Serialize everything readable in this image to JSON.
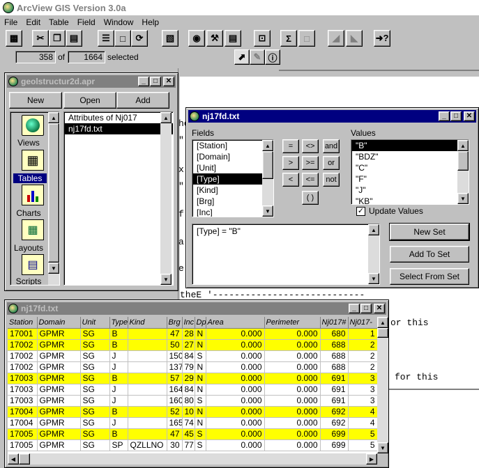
{
  "app": {
    "title": "ArcView GIS Version 3.0a",
    "menu": [
      "File",
      "Edit",
      "Table",
      "Field",
      "Window",
      "Help"
    ]
  },
  "status": {
    "selected_count": "358",
    "of_label": "of",
    "total_count": "1664",
    "selected_label": "selected"
  },
  "project": {
    "title": "geolstructur2d.apr",
    "buttons": {
      "new": "New",
      "open": "Open",
      "add": "Add"
    },
    "categories": [
      {
        "label": "Views"
      },
      {
        "label": "Tables"
      },
      {
        "label": "Charts"
      },
      {
        "label": "Layouts"
      },
      {
        "label": "Scripts"
      }
    ],
    "items": [
      "Attributes of Nj017",
      "nj17fd.txt"
    ]
  },
  "query": {
    "title": "nj17fd.txt",
    "fields_label": "Fields",
    "values_label": "Values",
    "fields": [
      "[Station]",
      "[Domain]",
      "[Unit]",
      "[Type]",
      "[Kind]",
      "[Brg]",
      "[Inc]"
    ],
    "operators": [
      "=",
      "<>",
      "and",
      ">",
      ">=",
      "or",
      "<",
      "<=",
      "not",
      "( )"
    ],
    "values": [
      "\"B\"",
      "\"BDZ\"",
      "\"C\"",
      "\"F\"",
      "\"J\"",
      "\"KB\""
    ],
    "update_values": "Update Values",
    "expression": "[Type] = \"B\"",
    "new_set": "New Set",
    "add_to_set": "Add To Set",
    "select_from_set": "Select From Set"
  },
  "script_bg": {
    "lines": [
      "he",
      "\"",
      "x",
      "\"",
      "f",
      "a.",
      "e"
    ],
    "tail_line": "theE '----------------------------",
    "right1": "or this",
    "right2": "for this"
  },
  "table": {
    "title": "nj17fd.txt",
    "columns": [
      "Station",
      "Domain",
      "Unit",
      "Type",
      "Kind",
      "Brg",
      "Inc",
      "Dp",
      "Area",
      "Perimeter",
      "Nj017#",
      "Nj017-"
    ],
    "rows": [
      {
        "sel": true,
        "c": [
          "17001",
          "GPMR",
          "SG",
          "B",
          "",
          "47",
          "28",
          "N",
          "0.000",
          "0.000",
          "680",
          "1"
        ]
      },
      {
        "sel": true,
        "c": [
          "17002",
          "GPMR",
          "SG",
          "B",
          "",
          "50",
          "27",
          "N",
          "0.000",
          "0.000",
          "688",
          "2"
        ]
      },
      {
        "sel": false,
        "c": [
          "17002",
          "GPMR",
          "SG",
          "J",
          "",
          "150",
          "84",
          "S",
          "0.000",
          "0.000",
          "688",
          "2"
        ]
      },
      {
        "sel": false,
        "c": [
          "17002",
          "GPMR",
          "SG",
          "J",
          "",
          "137",
          "79",
          "N",
          "0.000",
          "0.000",
          "688",
          "2"
        ]
      },
      {
        "sel": true,
        "c": [
          "17003",
          "GPMR",
          "SG",
          "B",
          "",
          "57",
          "29",
          "N",
          "0.000",
          "0.000",
          "691",
          "3"
        ]
      },
      {
        "sel": false,
        "c": [
          "17003",
          "GPMR",
          "SG",
          "J",
          "",
          "164",
          "84",
          "N",
          "0.000",
          "0.000",
          "691",
          "3"
        ]
      },
      {
        "sel": false,
        "c": [
          "17003",
          "GPMR",
          "SG",
          "J",
          "",
          "160",
          "80",
          "S",
          "0.000",
          "0.000",
          "691",
          "3"
        ]
      },
      {
        "sel": true,
        "c": [
          "17004",
          "GPMR",
          "SG",
          "B",
          "",
          "52",
          "10",
          "N",
          "0.000",
          "0.000",
          "692",
          "4"
        ]
      },
      {
        "sel": false,
        "c": [
          "17004",
          "GPMR",
          "SG",
          "J",
          "",
          "165",
          "74",
          "N",
          "0.000",
          "0.000",
          "692",
          "4"
        ]
      },
      {
        "sel": true,
        "c": [
          "17005",
          "GPMR",
          "SG",
          "B",
          "",
          "47",
          "45",
          "S",
          "0.000",
          "0.000",
          "699",
          "5"
        ]
      },
      {
        "sel": false,
        "c": [
          "17005",
          "GPMR",
          "SG",
          "SP",
          "QZLLNO",
          "30",
          "77",
          "S",
          "0.000",
          "0.000",
          "699",
          "5"
        ]
      }
    ]
  }
}
